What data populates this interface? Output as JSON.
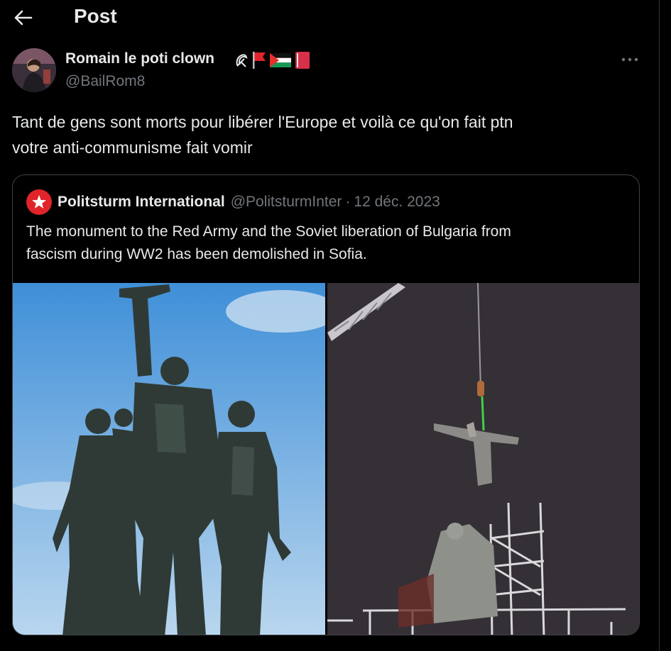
{
  "header": {
    "title": "Post"
  },
  "author": {
    "name": "Romain le poti clown",
    "handle": "@BailRom8",
    "emojis": [
      "sickle-icon",
      "red-flag-icon",
      "palestine-flag-icon",
      "red-book-icon"
    ]
  },
  "tweet": {
    "lines": [
      "Tant de gens sont morts pour libérer l'Europe et voilà ce qu'on fait ptn",
      "votre anti-communisme fait vomir"
    ]
  },
  "quote": {
    "name": "Politsturm International",
    "handle": "@PolitsturmInter",
    "separator": "·",
    "date": "12 déc. 2023",
    "lines": [
      "The monument to the Red Army and the Soviet liberation of Bulgaria from",
      "fascism during WW2 has been demolished in Sofia."
    ]
  },
  "colors": {
    "background": "#000000",
    "text": "#e7e9ea",
    "secondary": "#71767b",
    "border": "#2f3336",
    "brand_red": "#e0242a"
  }
}
